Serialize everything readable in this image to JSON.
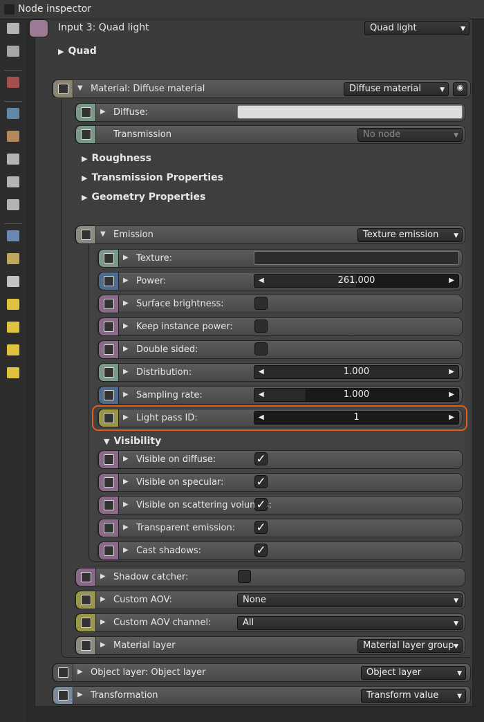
{
  "window": {
    "title": "Node inspector"
  },
  "header": {
    "title": "Input 3: Quad light",
    "dropdown": "Quad light"
  },
  "sections": {
    "quad": "Quad",
    "roughness": "Roughness",
    "transmission_props": "Transmission Properties",
    "geometry_props": "Geometry Properties",
    "visibility": "Visibility"
  },
  "material": {
    "label": "Material: Diffuse material",
    "dropdown": "Diffuse material"
  },
  "diffuse": {
    "label": "Diffuse:",
    "color": "#dcdcdc"
  },
  "transmission": {
    "label": "Transmission",
    "dropdown": "No node"
  },
  "emission": {
    "label": "Emission",
    "dropdown": "Texture emission"
  },
  "emission_params": [
    {
      "label": "Texture:",
      "type": "texture",
      "icon": "texture-icon"
    },
    {
      "label": "Power:",
      "type": "slider",
      "value": "261.000",
      "fill": 0.5,
      "icon": "float-icon"
    },
    {
      "label": "Surface brightness:",
      "type": "bool",
      "checked": false,
      "icon": "bool-icon"
    },
    {
      "label": "Keep instance power:",
      "type": "bool",
      "checked": false,
      "icon": "bool-icon"
    },
    {
      "label": "Double sided:",
      "type": "bool",
      "checked": false,
      "icon": "bool-icon"
    },
    {
      "label": "Distribution:",
      "type": "slider",
      "value": "1.000",
      "fill": 1,
      "icon": "distribution-icon"
    },
    {
      "label": "Sampling rate:",
      "type": "slider",
      "value": "1.000",
      "fill": 0.25,
      "icon": "float-icon"
    },
    {
      "label": "Light pass ID:",
      "type": "slider",
      "value": "1",
      "fill": 0,
      "icon": "int-icon",
      "highlight": true
    }
  ],
  "visibility_params": [
    {
      "label": "Visible on diffuse:",
      "checked": true
    },
    {
      "label": "Visible on specular:",
      "checked": true
    },
    {
      "label": "Visible on scattering volumes:",
      "checked": true
    },
    {
      "label": "Transparent emission:",
      "checked": true
    },
    {
      "label": "Cast shadows:",
      "checked": true
    }
  ],
  "shadow_catcher": {
    "label": "Shadow catcher:",
    "checked": false
  },
  "custom_aov": {
    "label": "Custom AOV:",
    "dropdown": "None"
  },
  "custom_aov_channel": {
    "label": "Custom AOV channel:",
    "dropdown": "All"
  },
  "material_layer": {
    "label": "Material layer",
    "dropdown": "Material layer group"
  },
  "object_layer": {
    "label": "Object layer: Object layer",
    "dropdown": "Object layer"
  },
  "transformation": {
    "label": "Transformation",
    "dropdown": "Transform value"
  },
  "colors": {
    "highlight": "#e0601a",
    "texture": "#7a9888",
    "float": "#4f6c8c",
    "bool": "#8a6a88",
    "int": "#9a9648",
    "material": "#8a8470"
  }
}
